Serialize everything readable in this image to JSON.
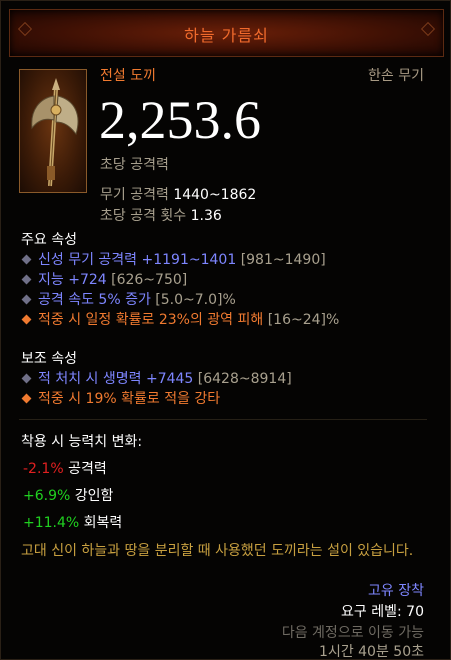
{
  "tooltip": {
    "title": "하늘 가름쇠",
    "rarity": "전설 도끼",
    "slot": "한손 무기",
    "icon": "axe-icon",
    "dps": "2,253.6",
    "dps_label": "초당 공격력",
    "weapon_damage_label": "무기 공격력",
    "weapon_damage_value": "1440~1862",
    "attack_speed_label": "초당 공격 횟수",
    "attack_speed_value": "1.36"
  },
  "primary": {
    "heading": "주요 속성",
    "affixes": [
      {
        "text": "신성 무기 공격력 +1191~1401",
        "range": "[981~1490]"
      },
      {
        "text": "지능 +724",
        "range": "[626~750]"
      },
      {
        "text": "공격 속도 5% 증가",
        "range": "[5.0~7.0]%"
      },
      {
        "text": "적중 시 일정 확률로 23%의 광역 피해",
        "range": "[16~24]%"
      }
    ]
  },
  "secondary": {
    "heading": "보조 속성",
    "affixes": [
      {
        "text": "적 처치 시 생명력 +7445",
        "range": "[6428~8914]"
      },
      {
        "text": "적중 시 19% 확률로 적을 강타",
        "range": ""
      }
    ]
  },
  "stat_changes": {
    "heading": "착용 시 능력치 변화:",
    "items": [
      {
        "delta": "-2.1%",
        "label": "공격력"
      },
      {
        "delta": "+6.9%",
        "label": "강인함"
      },
      {
        "delta": "+11.4%",
        "label": "회복력"
      }
    ]
  },
  "flavor": "고대 신이 하늘과 땅을 분리할 때 사용했던 도끼라는 설이 있습니다.",
  "footer": {
    "unique_equipped": "고유 장착",
    "required_level": "요구 레벨: 70",
    "account_bound": "다음 계정으로 이동 가능",
    "timer": "1시간 40분 50초"
  },
  "colors": {
    "legendary": "#f07a30",
    "magic": "#7e86ff",
    "negative": "#e02020",
    "positive": "#20d020",
    "flavor": "#c8a040"
  }
}
